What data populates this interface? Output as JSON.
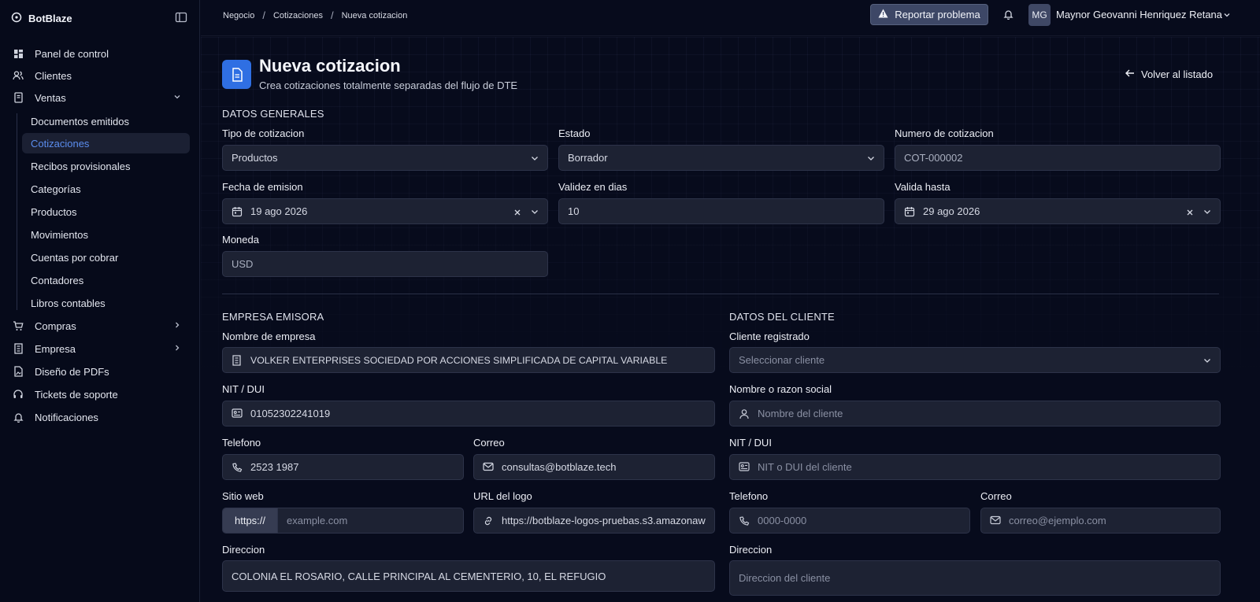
{
  "app": {
    "name": "BotBlaze"
  },
  "sidebar": {
    "items": [
      {
        "label": "Panel de control",
        "icon": "dashboard-icon"
      },
      {
        "label": "Clientes",
        "icon": "users-icon"
      },
      {
        "label": "Ventas",
        "icon": "receipt-icon"
      },
      {
        "label": "Documentos emitidos"
      },
      {
        "label": "Cotizaciones"
      },
      {
        "label": "Recibos provisionales"
      },
      {
        "label": "Categorías"
      },
      {
        "label": "Productos"
      },
      {
        "label": "Movimientos"
      },
      {
        "label": "Cuentas por cobrar"
      },
      {
        "label": "Contadores"
      },
      {
        "label": "Libros contables"
      },
      {
        "label": "Compras",
        "icon": "cart-icon"
      },
      {
        "label": "Empresa",
        "icon": "building-icon"
      },
      {
        "label": "Diseño de PDFs",
        "icon": "file-image-icon"
      },
      {
        "label": "Tickets de soporte",
        "icon": "headset-icon"
      },
      {
        "label": "Notificaciones",
        "icon": "bell-icon"
      }
    ]
  },
  "header": {
    "breadcrumbs": [
      "Negocio",
      "Cotizaciones",
      "Nueva cotizacion"
    ],
    "report_label": "Reportar problema",
    "avatar_initials": "MG",
    "user_name": "Maynor Geovanni Henriquez Retana"
  },
  "page": {
    "title": "Nueva cotizacion",
    "subtitle": "Crea cotizaciones totalmente separadas del flujo de DTE",
    "back_label": "Volver al listado"
  },
  "general": {
    "section": "DATOS GENERALES",
    "tipo_label": "Tipo de cotizacion",
    "tipo_value": "Productos",
    "estado_label": "Estado",
    "estado_value": "Borrador",
    "numero_label": "Numero de cotizacion",
    "numero_value": "COT-000002",
    "fecha_label": "Fecha de emision",
    "fecha_value": "19 ago 2026",
    "validez_label": "Validez en dias",
    "validez_value": "10",
    "valida_label": "Valida hasta",
    "valida_value": "29 ago 2026",
    "moneda_label": "Moneda",
    "moneda_value": "USD"
  },
  "empresa": {
    "section": "EMPRESA EMISORA",
    "nombre_label": "Nombre de empresa",
    "nombre_value": "VOLKER ENTERPRISES SOCIEDAD POR ACCIONES SIMPLIFICADA DE CAPITAL VARIABLE",
    "nit_label": "NIT / DUI",
    "nit_value": "01052302241019",
    "telefono_label": "Telefono",
    "telefono_value": "2523 1987",
    "correo_label": "Correo",
    "correo_value": "consultas@botblaze.tech",
    "web_label": "Sitio web",
    "web_prefix": "https://",
    "web_placeholder": "example.com",
    "logo_label": "URL del logo",
    "logo_value": "https://botblaze-logos-pruebas.s3.amazonaw",
    "direccion_label": "Direccion",
    "direccion_value": "COLONIA EL ROSARIO, CALLE PRINCIPAL AL CEMENTERIO, 10, EL REFUGIO"
  },
  "cliente": {
    "section": "DATOS DEL CLIENTE",
    "registrado_label": "Cliente registrado",
    "registrado_placeholder": "Seleccionar cliente",
    "nombre_label": "Nombre o razon social",
    "nombre_placeholder": "Nombre del cliente",
    "nit_label": "NIT / DUI",
    "nit_placeholder": "NIT o DUI del cliente",
    "telefono_label": "Telefono",
    "telefono_placeholder": "0000-0000",
    "correo_label": "Correo",
    "correo_placeholder": "correo@ejemplo.com",
    "direccion_label": "Direccion",
    "direccion_placeholder": "Direccion del cliente"
  }
}
